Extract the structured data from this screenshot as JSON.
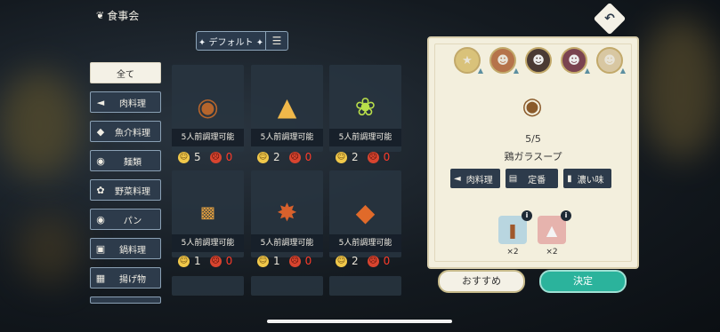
{
  "header": {
    "title": "食事会",
    "title_icon": "bowl-icon"
  },
  "sort": {
    "label": "デフォルト",
    "plus_icon": "plus-icon",
    "list_icon": "list-icon"
  },
  "categories": [
    {
      "label": "全て",
      "icon": ""
    },
    {
      "label": "肉料理",
      "icon": "meat-icon"
    },
    {
      "label": "魚介料理",
      "icon": "fish-icon"
    },
    {
      "label": "麺類",
      "icon": "noodle-icon"
    },
    {
      "label": "野菜料理",
      "icon": "vegetable-icon"
    },
    {
      "label": "パン",
      "icon": "bread-icon"
    },
    {
      "label": "鍋料理",
      "icon": "pot-icon"
    },
    {
      "label": "揚げ物",
      "icon": "fried-icon"
    }
  ],
  "recipes": [
    {
      "status": "5人前調理可能",
      "good": "5",
      "bad": "0",
      "dish_icon": "steak-icon"
    },
    {
      "status": "5人前調理可能",
      "good": "2",
      "bad": "0",
      "dish_icon": "cake-icon"
    },
    {
      "status": "5人前調理可能",
      "good": "2",
      "bad": "0",
      "dish_icon": "salad-icon"
    },
    {
      "status": "5人前調理可能",
      "good": "1",
      "bad": "0",
      "dish_icon": "drink-icon"
    },
    {
      "status": "5人前調理可能",
      "good": "1",
      "bad": "0",
      "dish_icon": "seafood-icon"
    },
    {
      "status": "5人前調理可能",
      "good": "2",
      "bad": "0",
      "dish_icon": "fried-shrimp-icon"
    }
  ],
  "detail": {
    "count": "5/5",
    "name": "鶏ガラスープ",
    "dish_icon": "soup-icon",
    "tags": [
      {
        "label": "肉料理",
        "icon": "meat-icon"
      },
      {
        "label": "定番",
        "icon": "book-icon"
      },
      {
        "label": "濃い味",
        "icon": "bottle-icon"
      }
    ],
    "ingredients": [
      {
        "icon": "chicken-bone-icon",
        "qty": "×2",
        "info": "i"
      },
      {
        "icon": "salt-icon",
        "qty": "×2",
        "info": "i"
      }
    ],
    "characters": [
      "character-1",
      "character-2",
      "character-3",
      "character-4",
      "character-5"
    ]
  },
  "buttons": {
    "recommend": "おすすめ",
    "confirm": "決定"
  },
  "colors": {
    "accent": "#2bb39c",
    "panel": "#f3efdd",
    "card": "#283440",
    "bad": "#ff3b2a"
  }
}
